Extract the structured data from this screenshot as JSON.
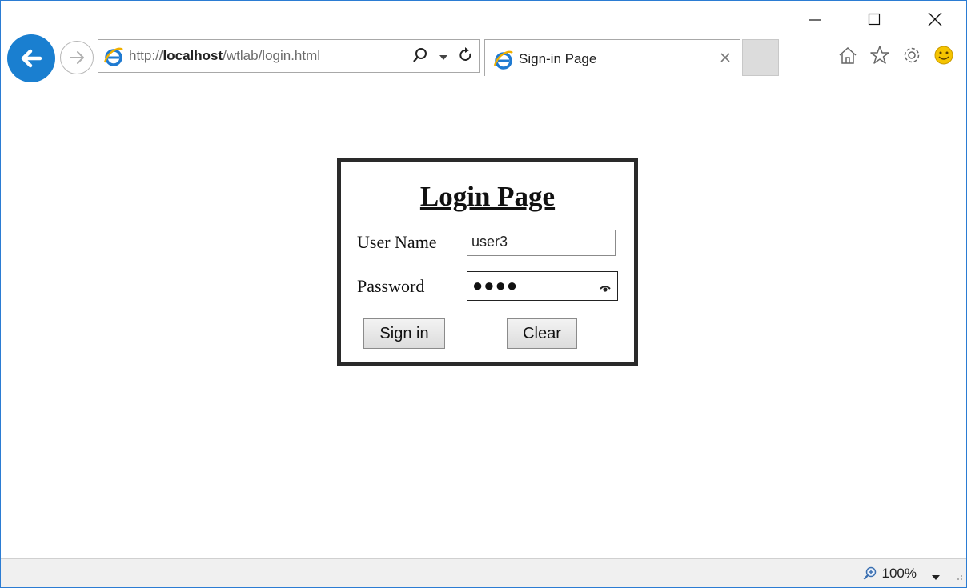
{
  "browser": {
    "address": {
      "prefix": "http://",
      "host": "localhost",
      "path": "/wtlab/login.html"
    },
    "tab": {
      "title": "Sign-in Page"
    },
    "icons": {
      "back": "back-arrow-icon",
      "forward": "forward-arrow-icon",
      "ie": "ie-logo-icon",
      "search": "search-icon",
      "dropdown": "dropdown-arrow-icon",
      "refresh": "refresh-icon",
      "close_tab": "close-icon",
      "home": "home-icon",
      "favorites": "star-icon",
      "settings": "gear-icon",
      "feedback": "smiley-icon",
      "minimize": "minimize-icon",
      "maximize": "maximize-icon",
      "close_window": "close-window-icon"
    },
    "status": {
      "zoom": "100%"
    }
  },
  "login": {
    "title": "Login Page",
    "username_label": "User Name",
    "username_value": "user3",
    "password_label": "Password",
    "password_mask": "●●●●",
    "signin_label": "Sign in",
    "clear_label": "Clear"
  },
  "colors": {
    "back_button": "#1a7fd0",
    "window_border": "#2b7cd3",
    "box_border": "#2a2a2a"
  }
}
